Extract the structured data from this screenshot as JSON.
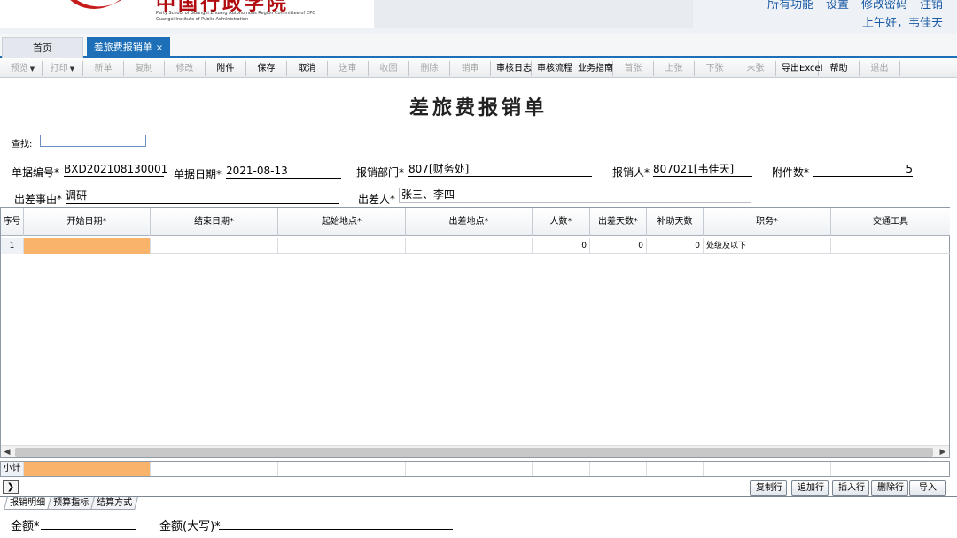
{
  "header": {
    "logo_cn": "中国行政学院",
    "logo_en_line1": "Party School of Guangxi Zhuang Autonomous Region Committee of CPC",
    "logo_en_line2": "Guangxi Institute of Public Administration",
    "top_links": [
      "所有功能",
      "设置",
      "修改密码",
      "注销"
    ],
    "greeting": "上午好，韦佳天",
    "accent_color": "#1d6fb8"
  },
  "tabs": {
    "home": "首页",
    "active": "差旅费报销单",
    "close_icon": "×"
  },
  "toolbar": [
    {
      "label": "预览",
      "enabled": false,
      "dropdown": true
    },
    {
      "label": "打印",
      "enabled": false,
      "dropdown": true
    },
    {
      "label": "新单",
      "enabled": false
    },
    {
      "label": "复制",
      "enabled": false
    },
    {
      "label": "修改",
      "enabled": false
    },
    {
      "label": "附件",
      "enabled": true
    },
    {
      "label": "保存",
      "enabled": true
    },
    {
      "label": "取消",
      "enabled": true
    },
    {
      "label": "送审",
      "enabled": false
    },
    {
      "label": "收回",
      "enabled": false
    },
    {
      "label": "删除",
      "enabled": false
    },
    {
      "label": "销审",
      "enabled": false
    },
    {
      "label": "审核日志",
      "enabled": true
    },
    {
      "label": "审核流程",
      "enabled": true
    },
    {
      "label": "业务指南",
      "enabled": true
    },
    {
      "label": "首张",
      "enabled": false
    },
    {
      "label": "上张",
      "enabled": false
    },
    {
      "label": "下张",
      "enabled": false
    },
    {
      "label": "末张",
      "enabled": false
    },
    {
      "label": "导出Excel",
      "enabled": true
    },
    {
      "label": "帮助",
      "enabled": true
    },
    {
      "label": "退出",
      "enabled": false
    }
  ],
  "form": {
    "title": "差旅费报销单",
    "search_label": "查找:",
    "doc_no_label": "单据编号*",
    "doc_no": "BXD202108130001",
    "doc_date_label": "单据日期*",
    "doc_date": "2021-08-13",
    "dept_label": "报销部门*",
    "dept": "807[财务处]",
    "claimant_label": "报销人*",
    "claimant": "807021[韦佳天]",
    "attach_count_label": "附件数*",
    "attach_count": "5",
    "reason_label": "出差事由*",
    "reason": "调研",
    "traveler_label": "出差人*",
    "traveler": "张三、李四"
  },
  "grid": {
    "columns": [
      "序号",
      "开始日期*",
      "结束日期*",
      "起始地点*",
      "出差地点*",
      "人数*",
      "出差天数*",
      "补助天数",
      "职务*",
      "交通工具"
    ],
    "rows": [
      {
        "no": "1",
        "start": "",
        "end": "",
        "from": "",
        "to": "",
        "people": "0",
        "days": "0",
        "subsidy_days": "0",
        "position": "处级及以下",
        "transport": ""
      }
    ],
    "subtotal_label": "小计",
    "selected_color": "#f9b36b"
  },
  "row_buttons": [
    "复制行",
    "追加行",
    "插入行",
    "删除行",
    "导入"
  ],
  "subtabs": [
    "报销明细",
    "预算指标",
    "结算方式"
  ],
  "footer": {
    "amount_label": "金额*",
    "amount_upper_label": "金额(大写)*"
  }
}
